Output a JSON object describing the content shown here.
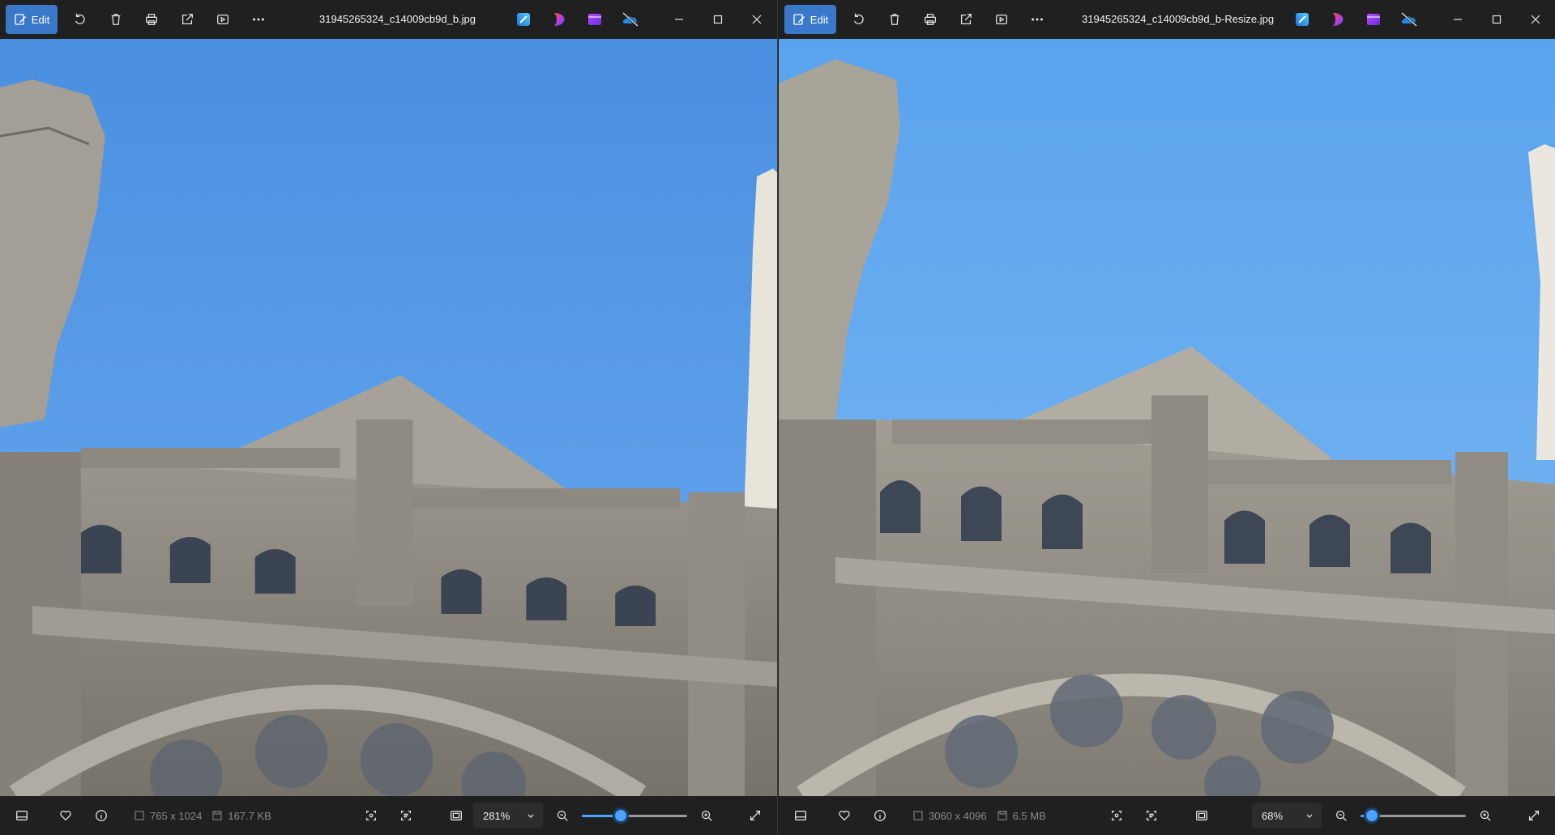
{
  "left": {
    "title": "31945265324_c14009cb9d_b.jpg",
    "edit_label": "Edit",
    "dimensions": "765 x 1024",
    "file_size": "167.7 KB",
    "zoom_label": "281%",
    "zoom_level": 0.37
  },
  "right": {
    "title": "31945265324_c14009cb9d_b-Resize.jpg",
    "edit_label": "Edit",
    "dimensions": "3060 x 4096",
    "file_size": "6.5 MB",
    "zoom_label": "68%",
    "zoom_level": 0.11
  },
  "toolbar_icons": [
    "edit-icon",
    "rotate-icon",
    "delete-icon",
    "print-icon",
    "share-icon",
    "slideshow-icon",
    "more-icon"
  ],
  "app_icons": [
    "designer-icon",
    "clipchamp-icon",
    "video-editor-icon",
    "onedrive-icon"
  ],
  "statusbar_icons": [
    "filmstrip-icon",
    "favorite-icon",
    "info-icon",
    "fit-icon",
    "ocr-icon",
    "actual-size-icon",
    "zoom-out-icon",
    "zoom-in-icon",
    "fullscreen-icon"
  ],
  "colors": {
    "accent": "#3a78c9",
    "slider": "#4aa3ff",
    "sky": "#5a9ee8",
    "stone": "#8c877d"
  }
}
